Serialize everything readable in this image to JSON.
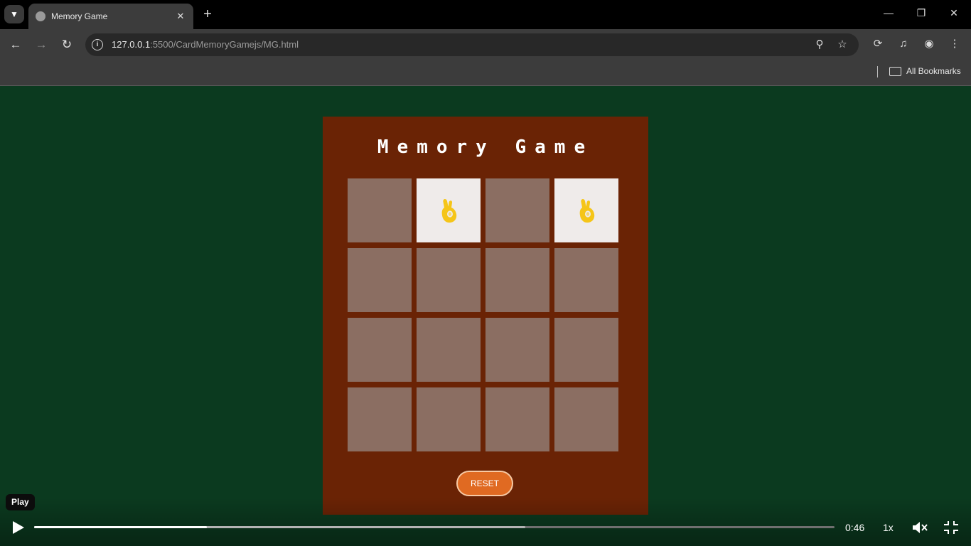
{
  "browser": {
    "tab_title": "Memory Game",
    "tab_close": "✕",
    "new_tab": "+",
    "url_host": "127.0.0.1",
    "url_path": ":5500/CardMemoryGamejs/MG.html",
    "bookmarks_label": "All Bookmarks"
  },
  "game": {
    "title": "Memory Game",
    "reset_label": "RESET",
    "card_emoji": "ok-hand-emoji",
    "accent_color": "#e06a22",
    "cards": [
      {
        "flipped": false
      },
      {
        "flipped": true
      },
      {
        "flipped": false
      },
      {
        "flipped": true
      },
      {
        "flipped": false
      },
      {
        "flipped": false
      },
      {
        "flipped": false
      },
      {
        "flipped": false
      },
      {
        "flipped": false
      },
      {
        "flipped": false
      },
      {
        "flipped": false
      },
      {
        "flipped": false
      },
      {
        "flipped": false
      },
      {
        "flipped": false
      },
      {
        "flipped": false
      },
      {
        "flipped": false
      }
    ]
  },
  "video": {
    "tooltip": "Play",
    "time": "0:46",
    "speed": "1x",
    "played_fraction": 0.216,
    "buffered_fraction": 0.614
  }
}
